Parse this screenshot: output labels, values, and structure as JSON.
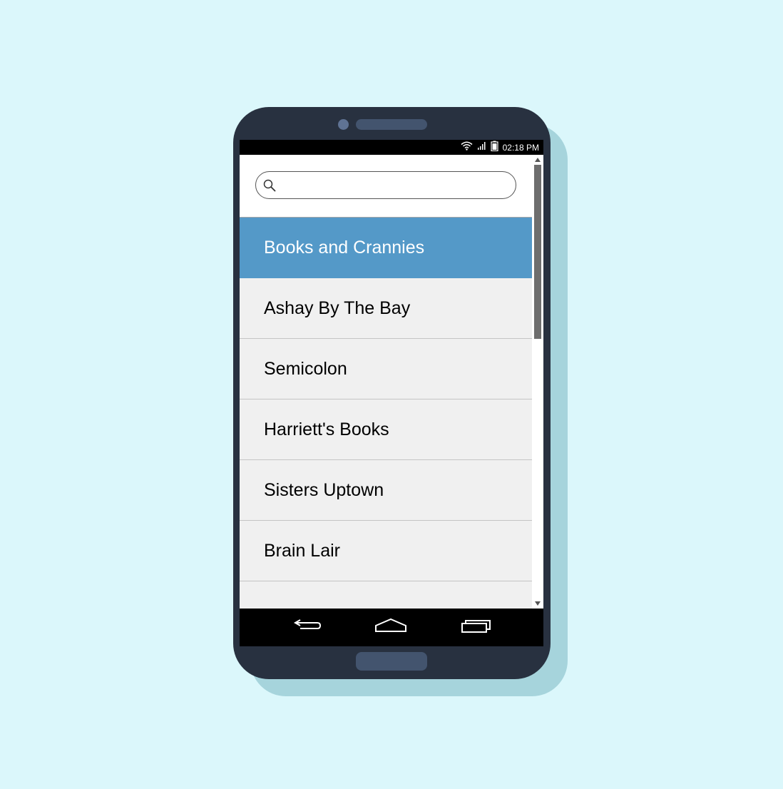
{
  "status_bar": {
    "time": "02:18 PM",
    "icons": [
      "wifi-icon",
      "signal-icon",
      "battery-icon"
    ]
  },
  "search": {
    "placeholder": "",
    "value": ""
  },
  "list": {
    "items": [
      {
        "label": "Books and Crannies",
        "selected": true
      },
      {
        "label": "Ashay By The Bay",
        "selected": false
      },
      {
        "label": "Semicolon",
        "selected": false
      },
      {
        "label": "Harriett's Books",
        "selected": false
      },
      {
        "label": "Sisters Uptown",
        "selected": false
      },
      {
        "label": "Brain Lair",
        "selected": false
      },
      {
        "label": "",
        "selected": false
      }
    ]
  },
  "nav_bar": {
    "buttons": [
      "back-icon",
      "home-icon",
      "recents-icon"
    ]
  },
  "colors": {
    "background": "#dbf7fb",
    "phone_body": "#283140",
    "selected_item": "#5499c8",
    "list_item": "#f0f0f0"
  }
}
